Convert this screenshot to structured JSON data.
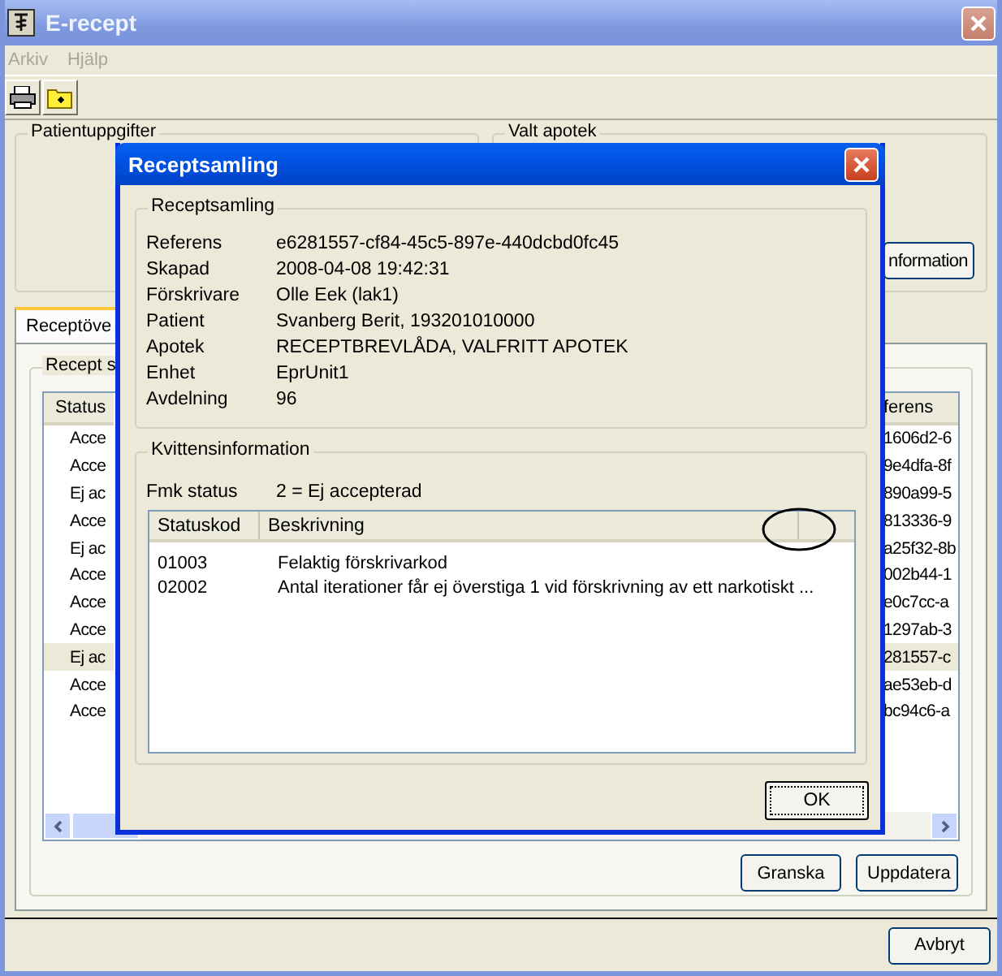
{
  "window": {
    "title": "E-recept"
  },
  "menu": [
    {
      "label": "Arkiv",
      "disabled": true
    },
    {
      "label": "Hjälp",
      "disabled": true
    }
  ],
  "toolbar": [
    {
      "kind": "print"
    },
    {
      "kind": "folder"
    }
  ],
  "patient_group": {
    "title": "Patientuppgifter"
  },
  "pharmacy_group": {
    "title": "Valt apotek",
    "button": "nformation"
  },
  "tabs": [
    {
      "label": "Receptöve",
      "selected": true
    }
  ],
  "prescriptions": {
    "title": "Recept s",
    "columns": [
      "Status",
      "ferens"
    ],
    "rows": [
      {
        "status": "Acce",
        "reference": "1606d2-6",
        "selected": false
      },
      {
        "status": "Acce",
        "reference": "9e4dfa-8f",
        "selected": false
      },
      {
        "status": "Ej ac",
        "reference": "890a99-5",
        "selected": false
      },
      {
        "status": "Acce",
        "reference": "813336-9",
        "selected": false
      },
      {
        "status": "Ej ac",
        "reference": "a25f32-8b",
        "selected": false
      },
      {
        "status": "Acce",
        "reference": "002b44-1",
        "selected": false
      },
      {
        "status": "Acce",
        "reference": "e0c7cc-a",
        "selected": false
      },
      {
        "status": "Acce",
        "reference": "1297ab-3",
        "selected": false
      },
      {
        "status": "Ej ac",
        "reference": "281557-c",
        "selected": true
      },
      {
        "status": "Acce",
        "reference": "ae53eb-d",
        "selected": false
      },
      {
        "status": "Acce",
        "reference": "bc94c6-a",
        "selected": false
      }
    ]
  },
  "buttons": [
    "Granska",
    "Uppdatera"
  ],
  "cancel": "Avbryt",
  "dialog": {
    "title": "Receptsamling",
    "group": "Receptsamling",
    "fields": [
      {
        "label": "Referens",
        "value": "e6281557-cf84-45c5-897e-440dcbd0fc45"
      },
      {
        "label": "Skapad",
        "value": "2008-04-08 19:42:31"
      },
      {
        "label": "Förskrivare",
        "value": "Olle Eek (lak1)"
      },
      {
        "label": "Patient",
        "value": "Svanberg Berit, 193201010000"
      },
      {
        "label": "Apotek",
        "value": "RECEPTBREVLÅDA, VALFRITT APOTEK"
      },
      {
        "label": "Enhet",
        "value": "EprUnit1"
      },
      {
        "label": "Avdelning",
        "value": "96"
      }
    ],
    "receipt": {
      "title": "Kvittensinformation",
      "fmk_label": "Fmk status",
      "fmk_value": "2 = Ej accepterad",
      "columns": [
        "Statuskod",
        "Beskrivning"
      ],
      "rows": [
        {
          "code": "01003",
          "description": "Felaktig förskrivarkod"
        },
        {
          "code": "02002",
          "description": "Antal iterationer får ej överstiga 1 vid förskrivning av ett narkotiskt ..."
        }
      ]
    },
    "ok": "OK"
  }
}
